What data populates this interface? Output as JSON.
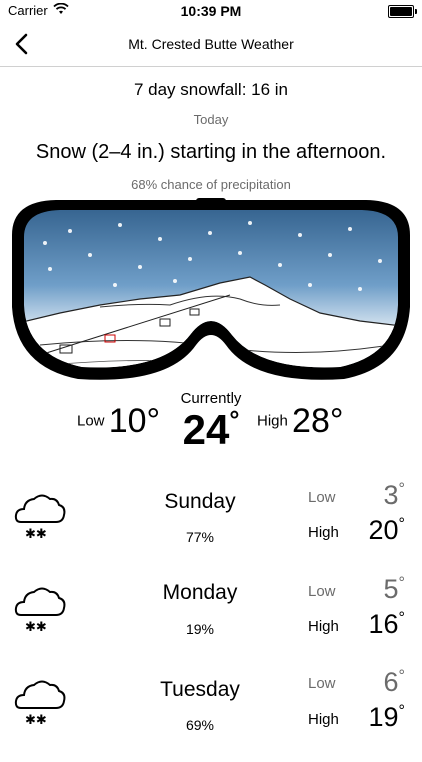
{
  "status": {
    "carrier": "Carrier",
    "time": "10:39 PM"
  },
  "nav": {
    "title": "Mt. Crested Butte Weather"
  },
  "summary": {
    "snowfall": "7 day snowfall: 16 in",
    "period": "Today",
    "forecast": "Snow (2–4 in.) starting in the afternoon.",
    "precip": "68% chance of precipitation"
  },
  "current": {
    "label": "Currently",
    "temp": "24",
    "low_label": "Low",
    "low": "10",
    "high_label": "High",
    "high": "28",
    "degree": "°"
  },
  "days": [
    {
      "name": "Sunday",
      "precip": "77%",
      "low_label": "Low",
      "low": "3",
      "high_label": "High",
      "high": "20"
    },
    {
      "name": "Monday",
      "precip": "19%",
      "low_label": "Low",
      "low": "5",
      "high_label": "High",
      "high": "16"
    },
    {
      "name": "Tuesday",
      "precip": "69%",
      "low_label": "Low",
      "low": "6",
      "high_label": "High",
      "high": "19"
    }
  ],
  "icons": {
    "back": "chevron-left-icon",
    "weather": "cloud-snow-icon",
    "wifi": "wifi-icon",
    "battery": "battery-icon"
  },
  "colors": {
    "goggle_sky_top": "#2c5a86",
    "goggle_sky_bottom": "#e9f1f8",
    "frame": "#000000",
    "muted_text": "#6b6b6b"
  }
}
